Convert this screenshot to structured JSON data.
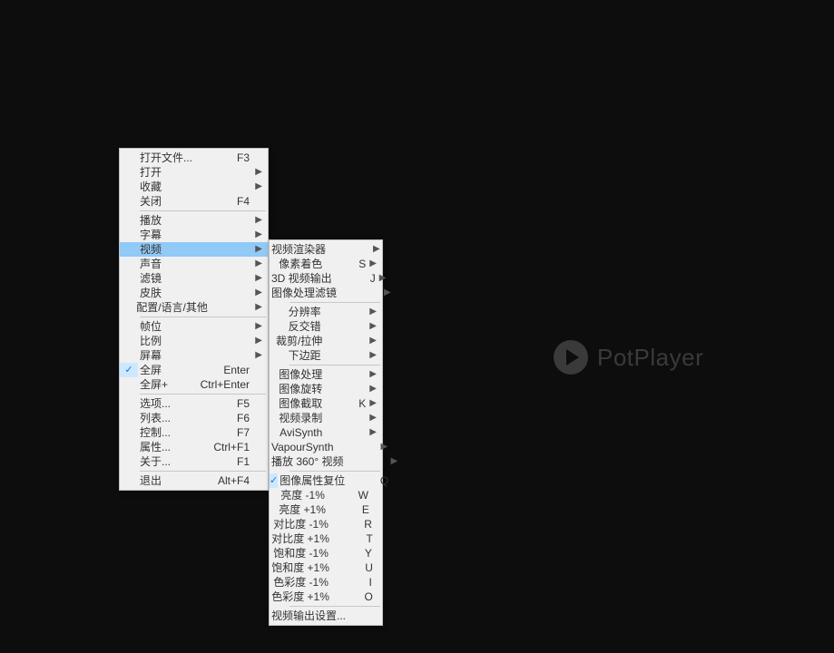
{
  "logo": {
    "text": "PotPlayer"
  },
  "main_menu": {
    "items": [
      {
        "label": "打开文件...",
        "shortcut": "F3",
        "arrow": false
      },
      {
        "label": "打开",
        "shortcut": "",
        "arrow": true
      },
      {
        "label": "收藏",
        "shortcut": "",
        "arrow": true
      },
      {
        "label": "关闭",
        "shortcut": "F4",
        "arrow": false
      },
      {
        "sep": true
      },
      {
        "label": "播放",
        "shortcut": "",
        "arrow": true
      },
      {
        "label": "字幕",
        "shortcut": "",
        "arrow": true
      },
      {
        "label": "视频",
        "shortcut": "",
        "arrow": true,
        "highlight": true
      },
      {
        "label": "声音",
        "shortcut": "",
        "arrow": true
      },
      {
        "label": "滤镜",
        "shortcut": "",
        "arrow": true
      },
      {
        "label": "皮肤",
        "shortcut": "",
        "arrow": true
      },
      {
        "label": "配置/语言/其他",
        "shortcut": "",
        "arrow": true
      },
      {
        "sep": true
      },
      {
        "label": "帧位",
        "shortcut": "",
        "arrow": true
      },
      {
        "label": "比例",
        "shortcut": "",
        "arrow": true
      },
      {
        "label": "屏幕",
        "shortcut": "",
        "arrow": true
      },
      {
        "label": "全屏",
        "shortcut": "Enter",
        "arrow": false,
        "checked": true
      },
      {
        "label": "全屏+",
        "shortcut": "Ctrl+Enter",
        "arrow": false
      },
      {
        "sep": true
      },
      {
        "label": "选项...",
        "shortcut": "F5",
        "arrow": false
      },
      {
        "label": "列表...",
        "shortcut": "F6",
        "arrow": false
      },
      {
        "label": "控制...",
        "shortcut": "F7",
        "arrow": false
      },
      {
        "label": "属性...",
        "shortcut": "Ctrl+F1",
        "arrow": false
      },
      {
        "label": "关于...",
        "shortcut": "F1",
        "arrow": false
      },
      {
        "sep": true
      },
      {
        "label": "退出",
        "shortcut": "Alt+F4",
        "arrow": false
      }
    ]
  },
  "sub_menu": {
    "items": [
      {
        "label": "视频渲染器",
        "shortcut": "",
        "arrow": true
      },
      {
        "label": "像素着色",
        "shortcut": "S",
        "arrow": true
      },
      {
        "label": "3D 视频输出",
        "shortcut": "J",
        "arrow": true
      },
      {
        "label": "图像处理滤镜",
        "shortcut": "",
        "arrow": true
      },
      {
        "sep": true
      },
      {
        "label": "分辨率",
        "shortcut": "",
        "arrow": true
      },
      {
        "label": "反交错",
        "shortcut": "",
        "arrow": true
      },
      {
        "label": "裁剪/拉伸",
        "shortcut": "",
        "arrow": true
      },
      {
        "label": "下边距",
        "shortcut": "",
        "arrow": true
      },
      {
        "sep": true
      },
      {
        "label": "图像处理",
        "shortcut": "",
        "arrow": true
      },
      {
        "label": "图像旋转",
        "shortcut": "",
        "arrow": true
      },
      {
        "label": "图像截取",
        "shortcut": "K",
        "arrow": true
      },
      {
        "label": "视频录制",
        "shortcut": "",
        "arrow": true
      },
      {
        "label": "AviSynth",
        "shortcut": "",
        "arrow": true
      },
      {
        "label": "VapourSynth",
        "shortcut": "",
        "arrow": true
      },
      {
        "label": "播放 360° 视频",
        "shortcut": "",
        "arrow": true
      },
      {
        "sep": true
      },
      {
        "label": "图像属性复位",
        "shortcut": "Q",
        "arrow": false,
        "checked": true
      },
      {
        "label": "亮度 -1%",
        "shortcut": "W",
        "arrow": false
      },
      {
        "label": "亮度 +1%",
        "shortcut": "E",
        "arrow": false
      },
      {
        "label": "对比度 -1%",
        "shortcut": "R",
        "arrow": false
      },
      {
        "label": "对比度 +1%",
        "shortcut": "T",
        "arrow": false
      },
      {
        "label": "饱和度 -1%",
        "shortcut": "Y",
        "arrow": false
      },
      {
        "label": "饱和度 +1%",
        "shortcut": "U",
        "arrow": false
      },
      {
        "label": "色彩度 -1%",
        "shortcut": "I",
        "arrow": false
      },
      {
        "label": "色彩度 +1%",
        "shortcut": "O",
        "arrow": false
      },
      {
        "sep": true
      },
      {
        "label": "视频输出设置...",
        "shortcut": "",
        "arrow": false
      }
    ]
  }
}
